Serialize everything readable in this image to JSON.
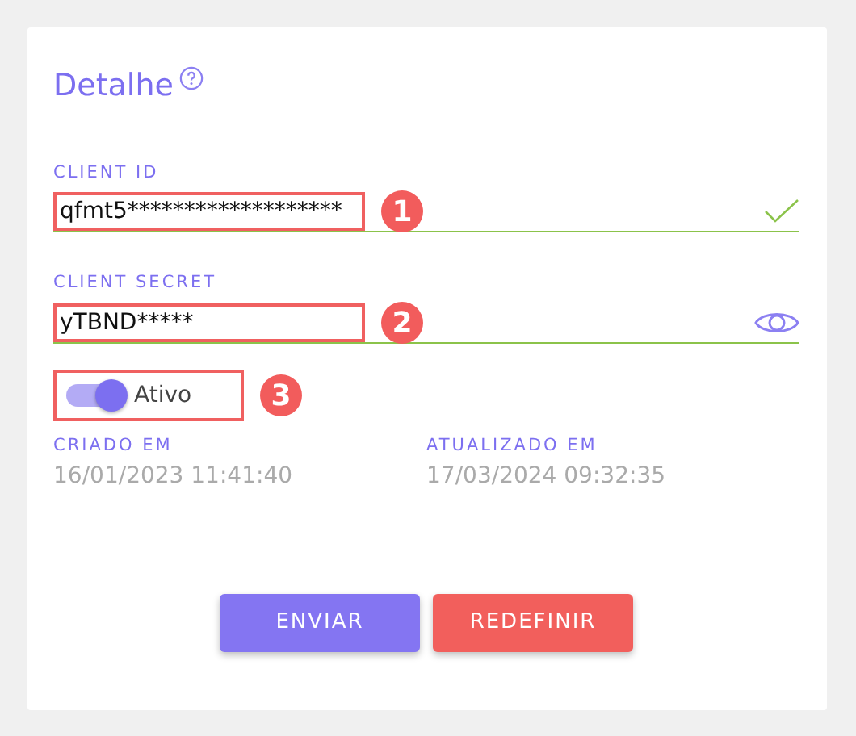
{
  "title": "Detalhe",
  "fields": [
    {
      "label": "CLIENT ID",
      "value": "qfmt5*******************",
      "kind": "check",
      "callout": "1"
    },
    {
      "label": "CLIENT SECRET",
      "value": "yTBND*****",
      "kind": "eye",
      "callout": "2"
    }
  ],
  "toggle": {
    "label": "Ativo",
    "on": true,
    "callout": "3"
  },
  "dates": [
    {
      "label": "CRIADO EM",
      "value": "16/01/2023 11:41:40"
    },
    {
      "label": "ATUALIZADO EM",
      "value": "17/03/2024 09:32:35"
    }
  ],
  "buttons": [
    {
      "label": "ENVIAR",
      "kind": "primary"
    },
    {
      "label": "REDEFINIR",
      "kind": "danger"
    }
  ]
}
